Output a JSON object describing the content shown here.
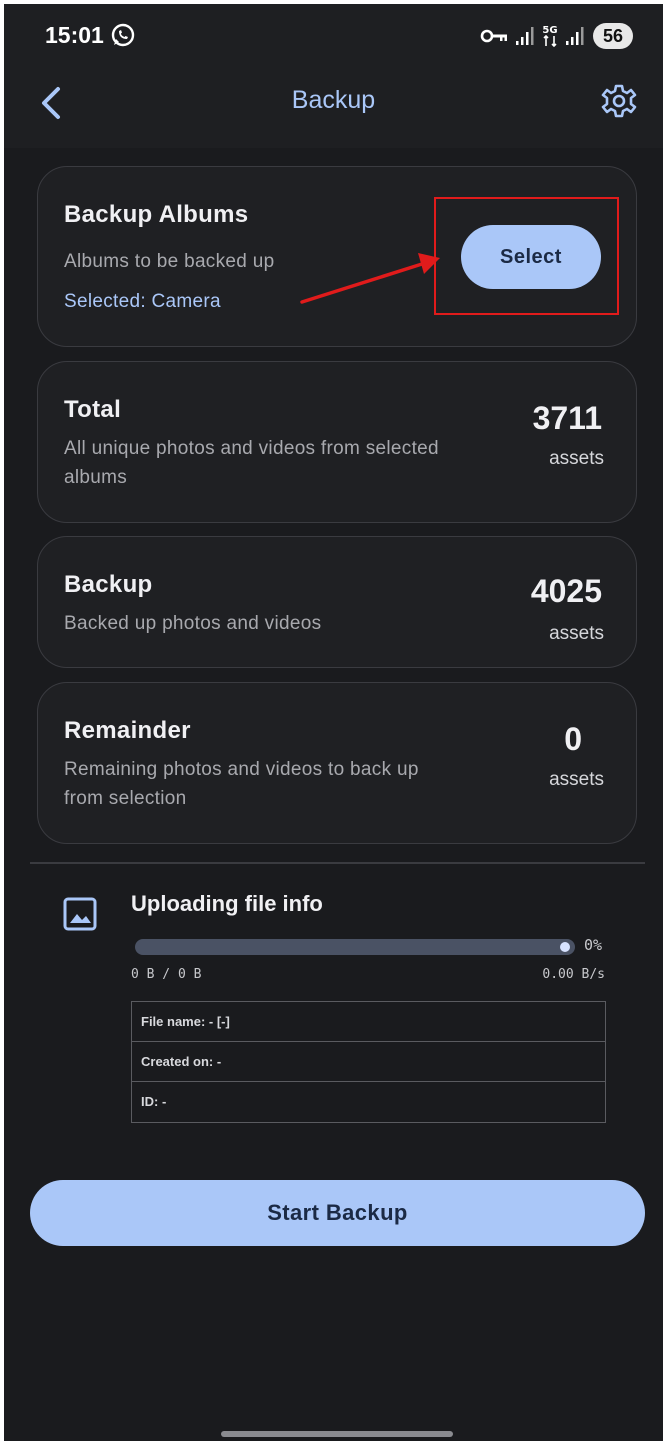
{
  "status_bar": {
    "time": "15:01",
    "network": "5G",
    "battery": "56"
  },
  "header": {
    "title": "Backup"
  },
  "cards": {
    "albums": {
      "title": "Backup Albums",
      "subtitle": "Albums to be backed up",
      "selected": "Selected: Camera",
      "select_label": "Select"
    },
    "total": {
      "title": "Total",
      "subtitle_line1": "All unique photos and videos from selected",
      "subtitle_line2": "albums",
      "count": "3711",
      "unit": "assets"
    },
    "backup": {
      "title": "Backup",
      "subtitle": "Backed up photos and videos",
      "count": "4025",
      "unit": "assets"
    },
    "remainder": {
      "title": "Remainder",
      "subtitle_line1": "Remaining photos and videos to back up",
      "subtitle_line2": "from selection",
      "count": "0",
      "unit": "assets"
    }
  },
  "upload": {
    "title": "Uploading file info",
    "progress_fraction": 1.0,
    "progress_label": "0%",
    "bytes": "0 B / 0 B",
    "speed": "0.00 B/s",
    "file_name": "File name: - [-]",
    "created_on": "Created on: -",
    "id": "ID: -"
  },
  "start_button": "Start Backup",
  "colors": {
    "accent": "#aac7f8",
    "background": "#1a1b1e",
    "highlight": "#e01b1b"
  },
  "icons": [
    "whatsapp-icon",
    "vpn-key-icon",
    "signal-icon",
    "back-chevron-icon",
    "gear-icon",
    "image-icon"
  ]
}
